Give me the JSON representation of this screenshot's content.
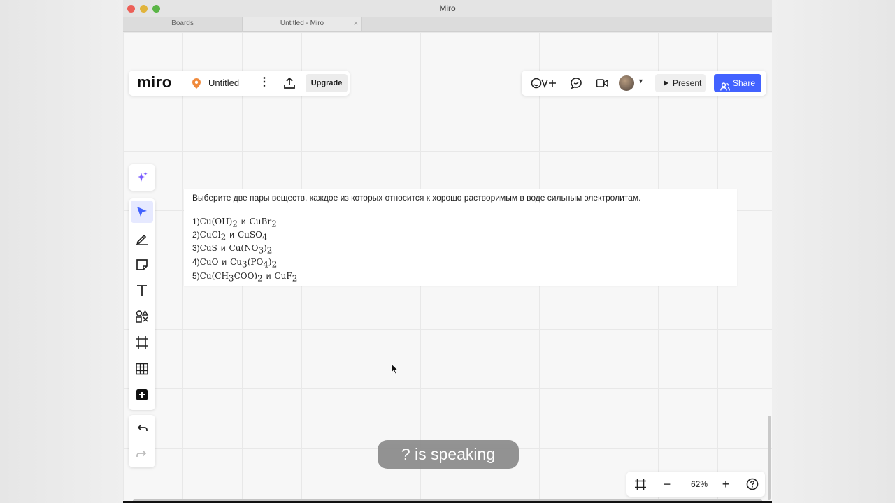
{
  "window": {
    "title": "Miro",
    "tabs": [
      {
        "label": "Boards"
      },
      {
        "label": "Untitled - Miro",
        "close": "×"
      }
    ]
  },
  "header": {
    "logo": "miro",
    "board_name": "Untitled",
    "more": "⋮",
    "upgrade_label": "Upgrade",
    "present_label": "Present",
    "share_label": "Share"
  },
  "board": {
    "question": "Выберите две пары веществ, каждое из которых относится к хорошо растворимым в воде сильным электролитам.",
    "options": [
      {
        "num": "1)",
        "a": "Cu(OH)",
        "a_sub": "2",
        "a_tail": "",
        "and": "и",
        "b": "CuBr",
        "b_sub": "2",
        "b_tail": ""
      },
      {
        "num": "2)",
        "a": "CuCl",
        "a_sub": "2",
        "a_tail": "",
        "and": "и",
        "b": "CuSO",
        "b_sub": "4",
        "b_tail": ""
      },
      {
        "num": "3)",
        "a": "CuS",
        "a_sub": "",
        "a_tail": "",
        "and": "и",
        "b": "Cu(NO",
        "b_sub": "3",
        "b_tail": ")",
        "b_sub2": "2"
      },
      {
        "num": "4)",
        "a": "CuO",
        "a_sub": "",
        "a_tail": "",
        "and": "и",
        "b": "Cu",
        "b_sub": "3",
        "b_tail": "(PO",
        "b_sub2": "4",
        "b_tail2": ")",
        "b_sub3": "2"
      },
      {
        "num": "5)",
        "a": "Cu(CH",
        "a_sub": "3",
        "a_tail": "COO)",
        "a_sub2": "2",
        "and": "и",
        "b": "CuF",
        "b_sub": "2",
        "b_tail": ""
      }
    ]
  },
  "overlay": {
    "speaking": "? is speaking"
  },
  "zoom": {
    "level": "62%",
    "minus": "−",
    "plus": "+"
  },
  "colors": {
    "accent": "#4262ff",
    "tool_selected": "#4262ff",
    "pin": "#f08a3c"
  },
  "icons": {
    "toolbar": [
      "ai-sparkle-icon",
      "select-arrow-icon",
      "pen-icon",
      "sticky-note-icon",
      "text-icon",
      "shapes-icon",
      "frame-icon",
      "table-icon",
      "add-apps-icon",
      "undo-icon",
      "redo-icon"
    ],
    "header": [
      "location-pin-icon",
      "more-icon",
      "export-icon",
      "reactions-icon",
      "comments-icon",
      "video-call-icon",
      "avatar",
      "chevron-down-icon"
    ],
    "zoom": [
      "fit-frame-icon",
      "zoom-out-icon",
      "zoom-in-icon",
      "help-icon"
    ]
  }
}
